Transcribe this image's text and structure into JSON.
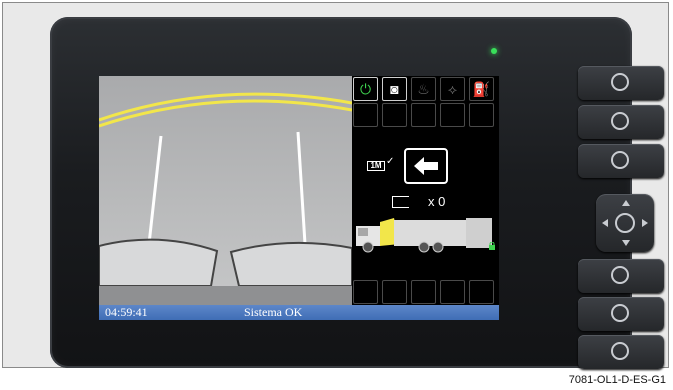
{
  "status": {
    "time": "04:59:41",
    "message": "Sistema OK"
  },
  "panel": {
    "top_icons": [
      {
        "name": "power-icon",
        "glyph": "⏻",
        "color": "green"
      },
      {
        "name": "face-camera-icon",
        "glyph": "◙",
        "color": "white"
      },
      {
        "name": "beacon-light-icon",
        "glyph": "♨",
        "color": "gray"
      },
      {
        "name": "wiper-icon",
        "glyph": "⟡",
        "color": "gray"
      },
      {
        "name": "fuel-icon",
        "glyph": "⛽",
        "color": "gray"
      }
    ],
    "indicator_label": "1M",
    "counter_text": "x 0"
  },
  "caption": "7081-OL1-D-ES-G1",
  "colors": {
    "status_bar": "#4a78bf",
    "active_green": "#3fd34f",
    "guide_yellow": "#f2e64a"
  }
}
